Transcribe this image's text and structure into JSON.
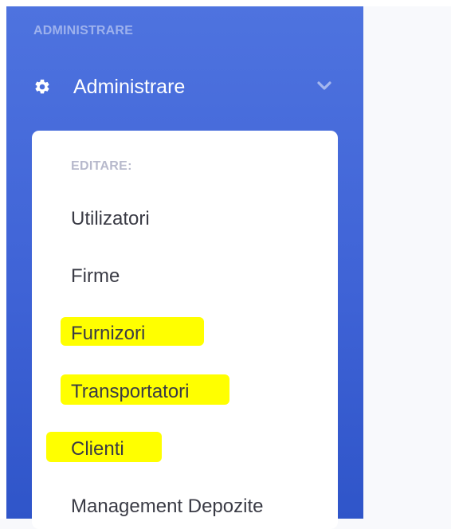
{
  "sidebar": {
    "heading": "ADMINISTRARE",
    "nav": {
      "icon": "gear-icon",
      "label": "Administrare",
      "toggle_icon": "chevron-down-icon"
    },
    "collapse": {
      "header": "EDITARE:",
      "items": [
        {
          "label": "Utilizatori",
          "highlighted": false
        },
        {
          "label": "Firme",
          "highlighted": false
        },
        {
          "label": "Furnizori",
          "highlighted": true
        },
        {
          "label": "Transportatori",
          "highlighted": true
        },
        {
          "label": "Clienti",
          "highlighted": true
        },
        {
          "label": "Management Depozite",
          "highlighted": false
        }
      ]
    }
  },
  "colors": {
    "sidebar_gradient_top": "#4e73df",
    "sidebar_gradient_bottom": "#2f55c9",
    "highlight": "#ffff00",
    "item_text": "#3a3b45",
    "header_text": "#b7b9cc"
  }
}
